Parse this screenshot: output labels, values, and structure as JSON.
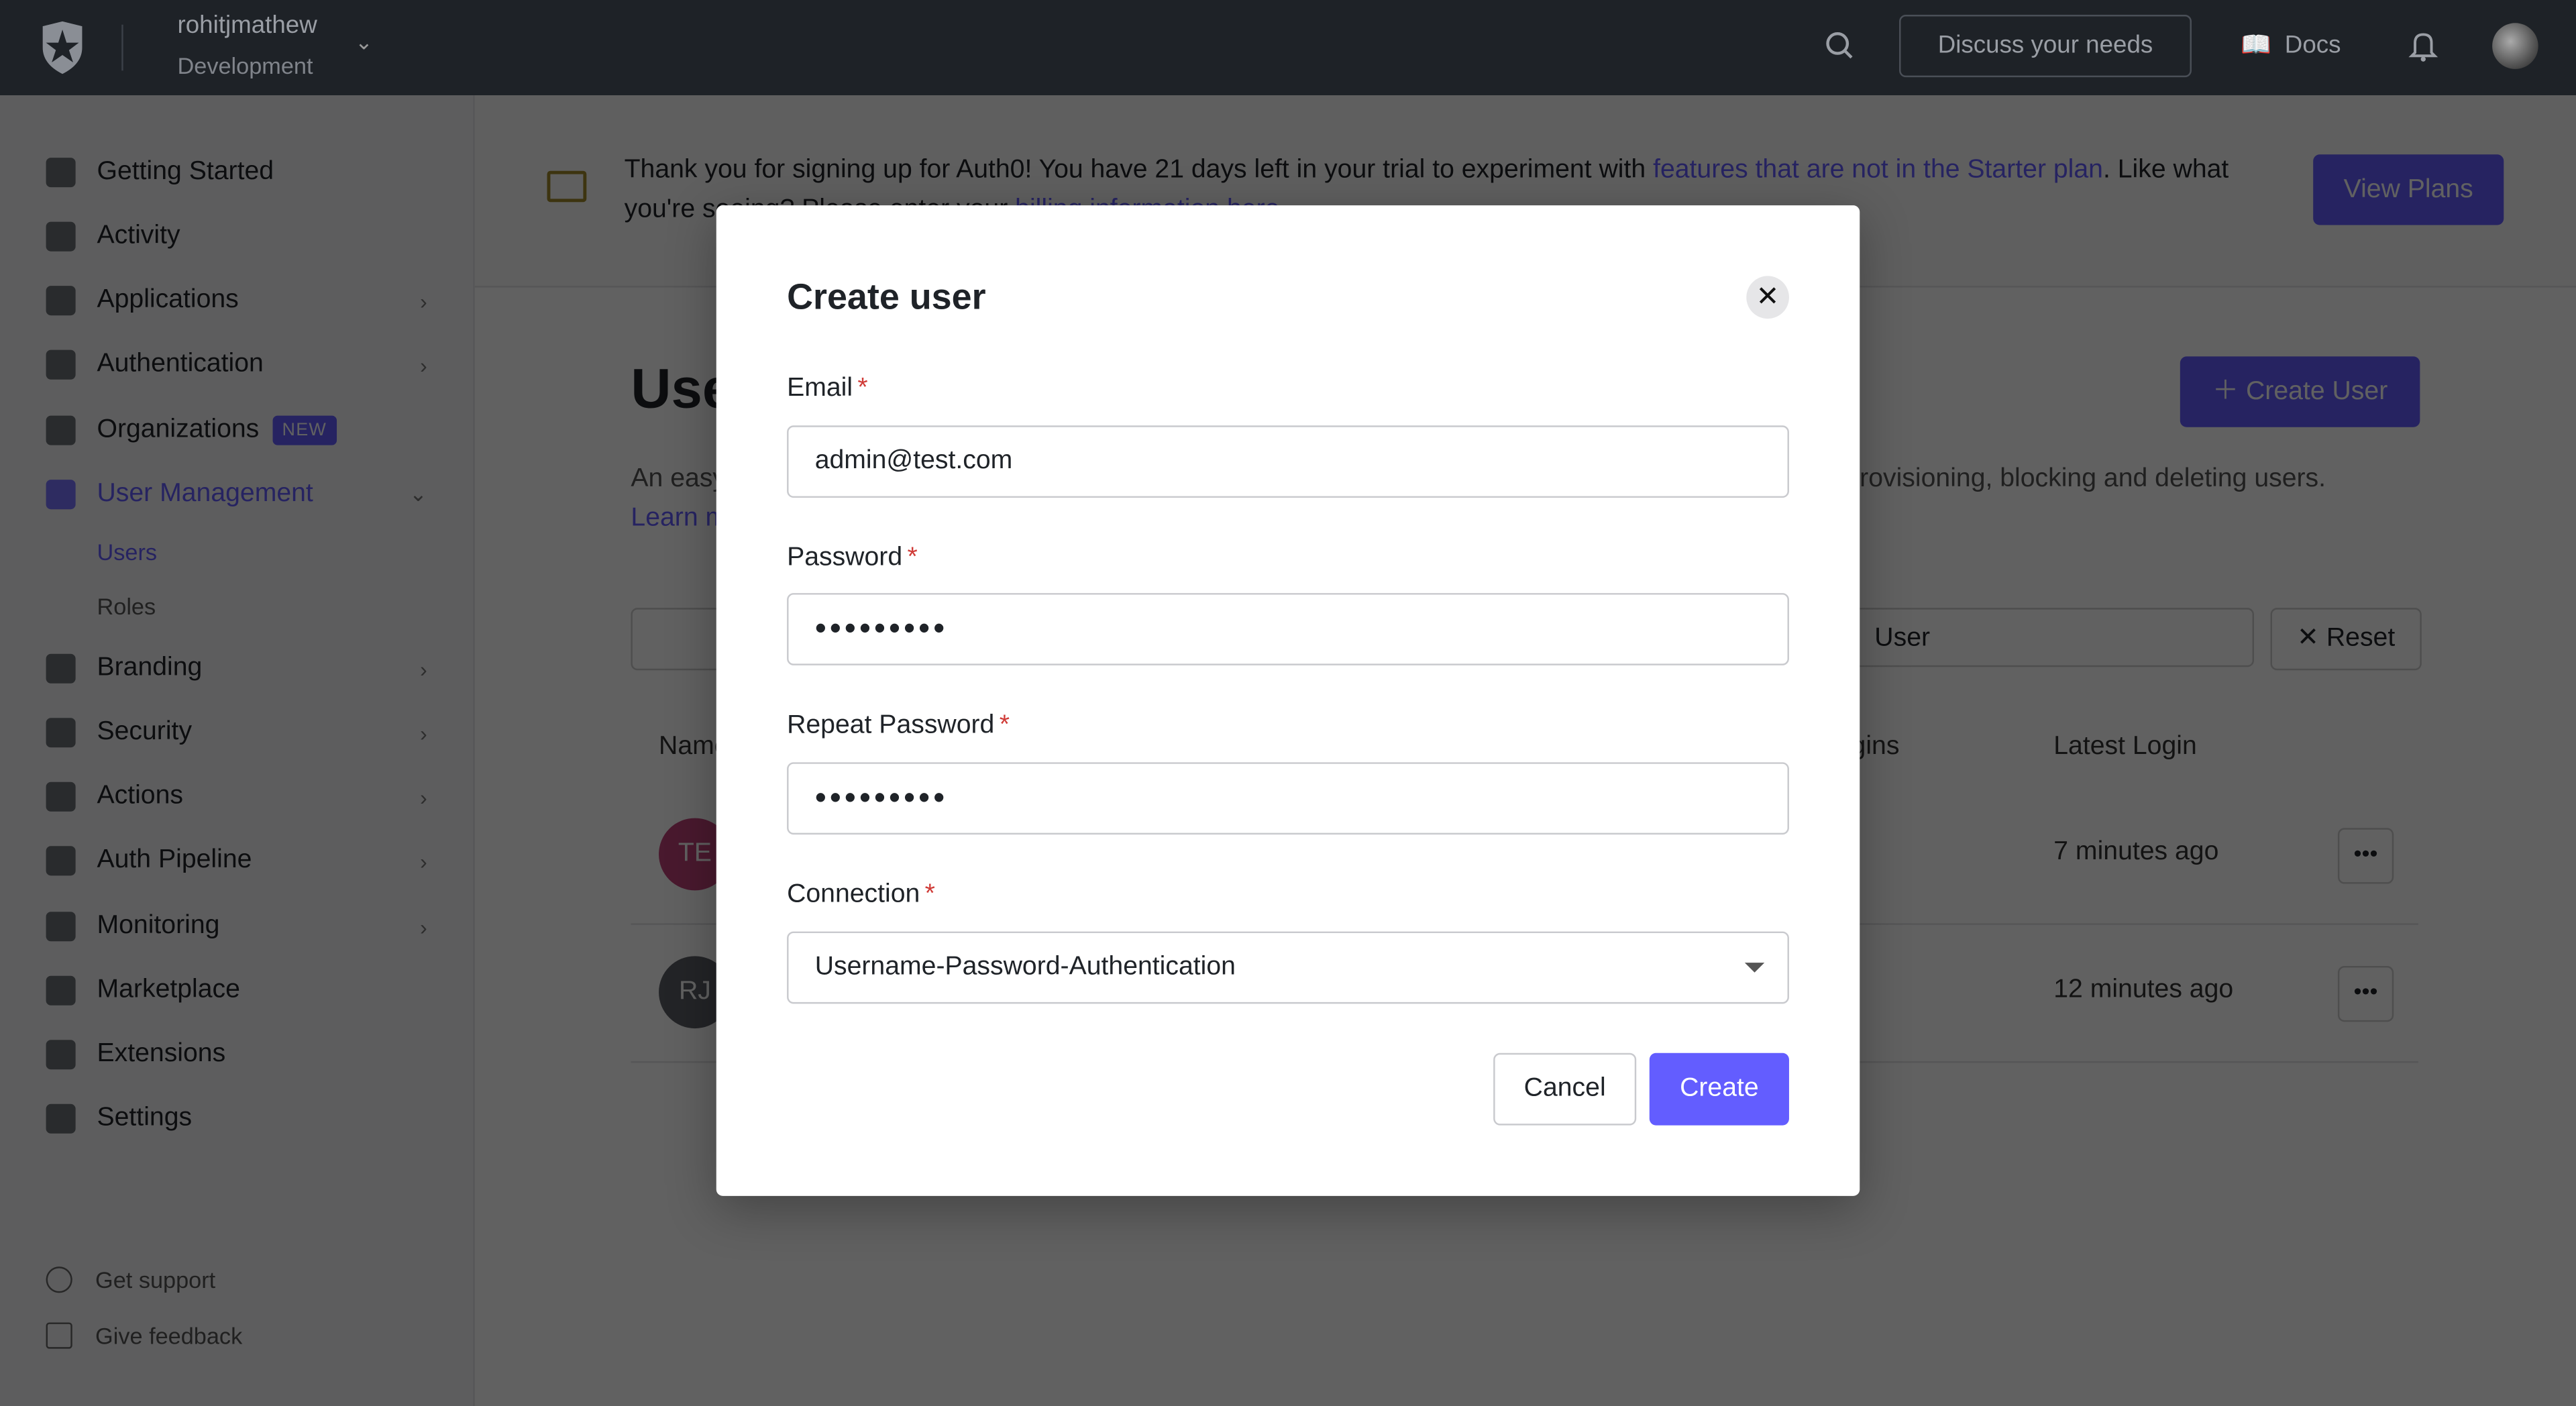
{
  "topbar": {
    "tenant": "rohitjmathew",
    "environment": "Development",
    "discuss": "Discuss your needs",
    "docs": "Docs"
  },
  "sidebar": {
    "items": [
      {
        "label": "Getting Started",
        "icon": "bolt-icon"
      },
      {
        "label": "Activity",
        "icon": "chart-icon"
      },
      {
        "label": "Applications",
        "icon": "layers-icon",
        "chevron": true
      },
      {
        "label": "Authentication",
        "icon": "lock-icon",
        "chevron": true
      },
      {
        "label": "Organizations",
        "icon": "building-icon",
        "badge": "NEW"
      },
      {
        "label": "User Management",
        "icon": "users-icon",
        "chevron": true,
        "active": true
      },
      {
        "label": "Branding",
        "icon": "brush-icon",
        "chevron": true
      },
      {
        "label": "Security",
        "icon": "shield-icon",
        "chevron": true
      },
      {
        "label": "Actions",
        "icon": "flow-icon",
        "chevron": true
      },
      {
        "label": "Auth Pipeline",
        "icon": "pipeline-icon",
        "chevron": true
      },
      {
        "label": "Monitoring",
        "icon": "bar-chart-icon",
        "chevron": true
      },
      {
        "label": "Marketplace",
        "icon": "grid-plus-icon"
      },
      {
        "label": "Extensions",
        "icon": "puzzle-icon"
      },
      {
        "label": "Settings",
        "icon": "gear-icon"
      }
    ],
    "subitems": [
      "Users",
      "Roles"
    ],
    "footer": [
      "Get support",
      "Give feedback"
    ]
  },
  "banner": {
    "text_before": "Thank you for signing up for Auth0! You have 21 days left in your trial to experiment with ",
    "link1": "features that are not in the Starter plan",
    "text_mid": ". Like what you're seeing? Please enter your ",
    "link2": "billing information here",
    "text_after": ".",
    "button": "View Plans"
  },
  "page": {
    "title": "Users",
    "create_button": "Create User",
    "description": "An easy to use UI to help administrators manage user identities including password resets, creating and provisioning, blocking and deleting users.",
    "learn": "Learn more",
    "filter_value": "User",
    "reset": "Reset",
    "columns": [
      "Name",
      "Logins",
      "Latest Login"
    ],
    "rows": [
      {
        "initials": "TE",
        "color": "#c0417a",
        "latest": "7 minutes ago"
      },
      {
        "initials": "RJ",
        "color": "#5d6066",
        "latest": "12 minutes ago"
      }
    ]
  },
  "modal": {
    "title": "Create user",
    "email_label": "Email",
    "email_value": "admin@test.com",
    "password_label": "Password",
    "password_value": "•••••••••",
    "repeat_label": "Repeat Password",
    "repeat_value": "•••••••••",
    "connection_label": "Connection",
    "connection_value": "Username-Password-Authentication",
    "cancel": "Cancel",
    "create": "Create",
    "required": "*"
  },
  "colors": {
    "accent": "#635dff",
    "topbar": "#1e2227",
    "required": "#d03c38"
  }
}
